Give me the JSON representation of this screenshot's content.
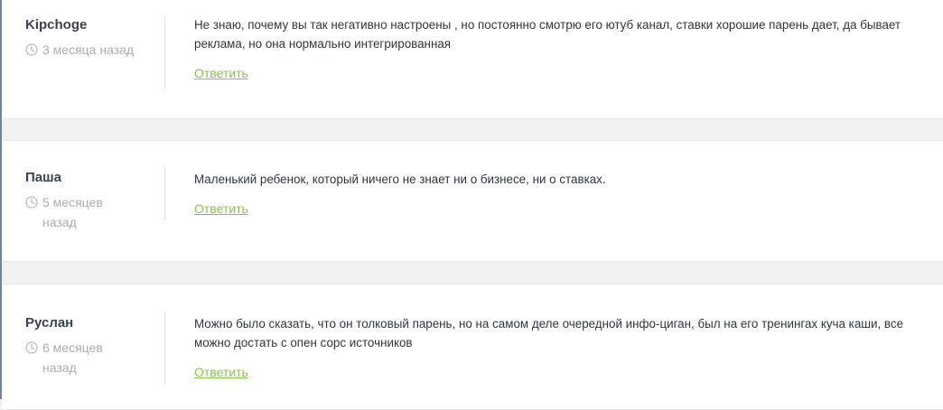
{
  "comments": [
    {
      "author": "Kipchoge",
      "time": "3 месяца назад",
      "text": "Не знаю, почему вы так негативно настроены , но постоянно смотрю его ютуб канал, ставки хорошие парень дает, да бывает реклама, но она нормально интегрированная",
      "reply_label": "Ответить"
    },
    {
      "author": "Паша",
      "time": "5 месяцев назад",
      "text": "Маленький ребенок, который ничего не знает ни о бизнесе, ни о ставках.",
      "reply_label": "Ответить"
    },
    {
      "author": "Руслан",
      "time": "6 месяцев назад",
      "text": "Можно было сказать, что он толковый парень, но на самом деле очередной инфо-циган, был на его тренингах куча каши, все можно достать с опен сорс источников",
      "reply_label": "Ответить"
    }
  ],
  "colors": {
    "accent": "#8cc152",
    "author": "#3a4350",
    "meta": "#a8acb3",
    "background": "#f2f2f2"
  },
  "icons": {
    "time": "clock-icon"
  }
}
